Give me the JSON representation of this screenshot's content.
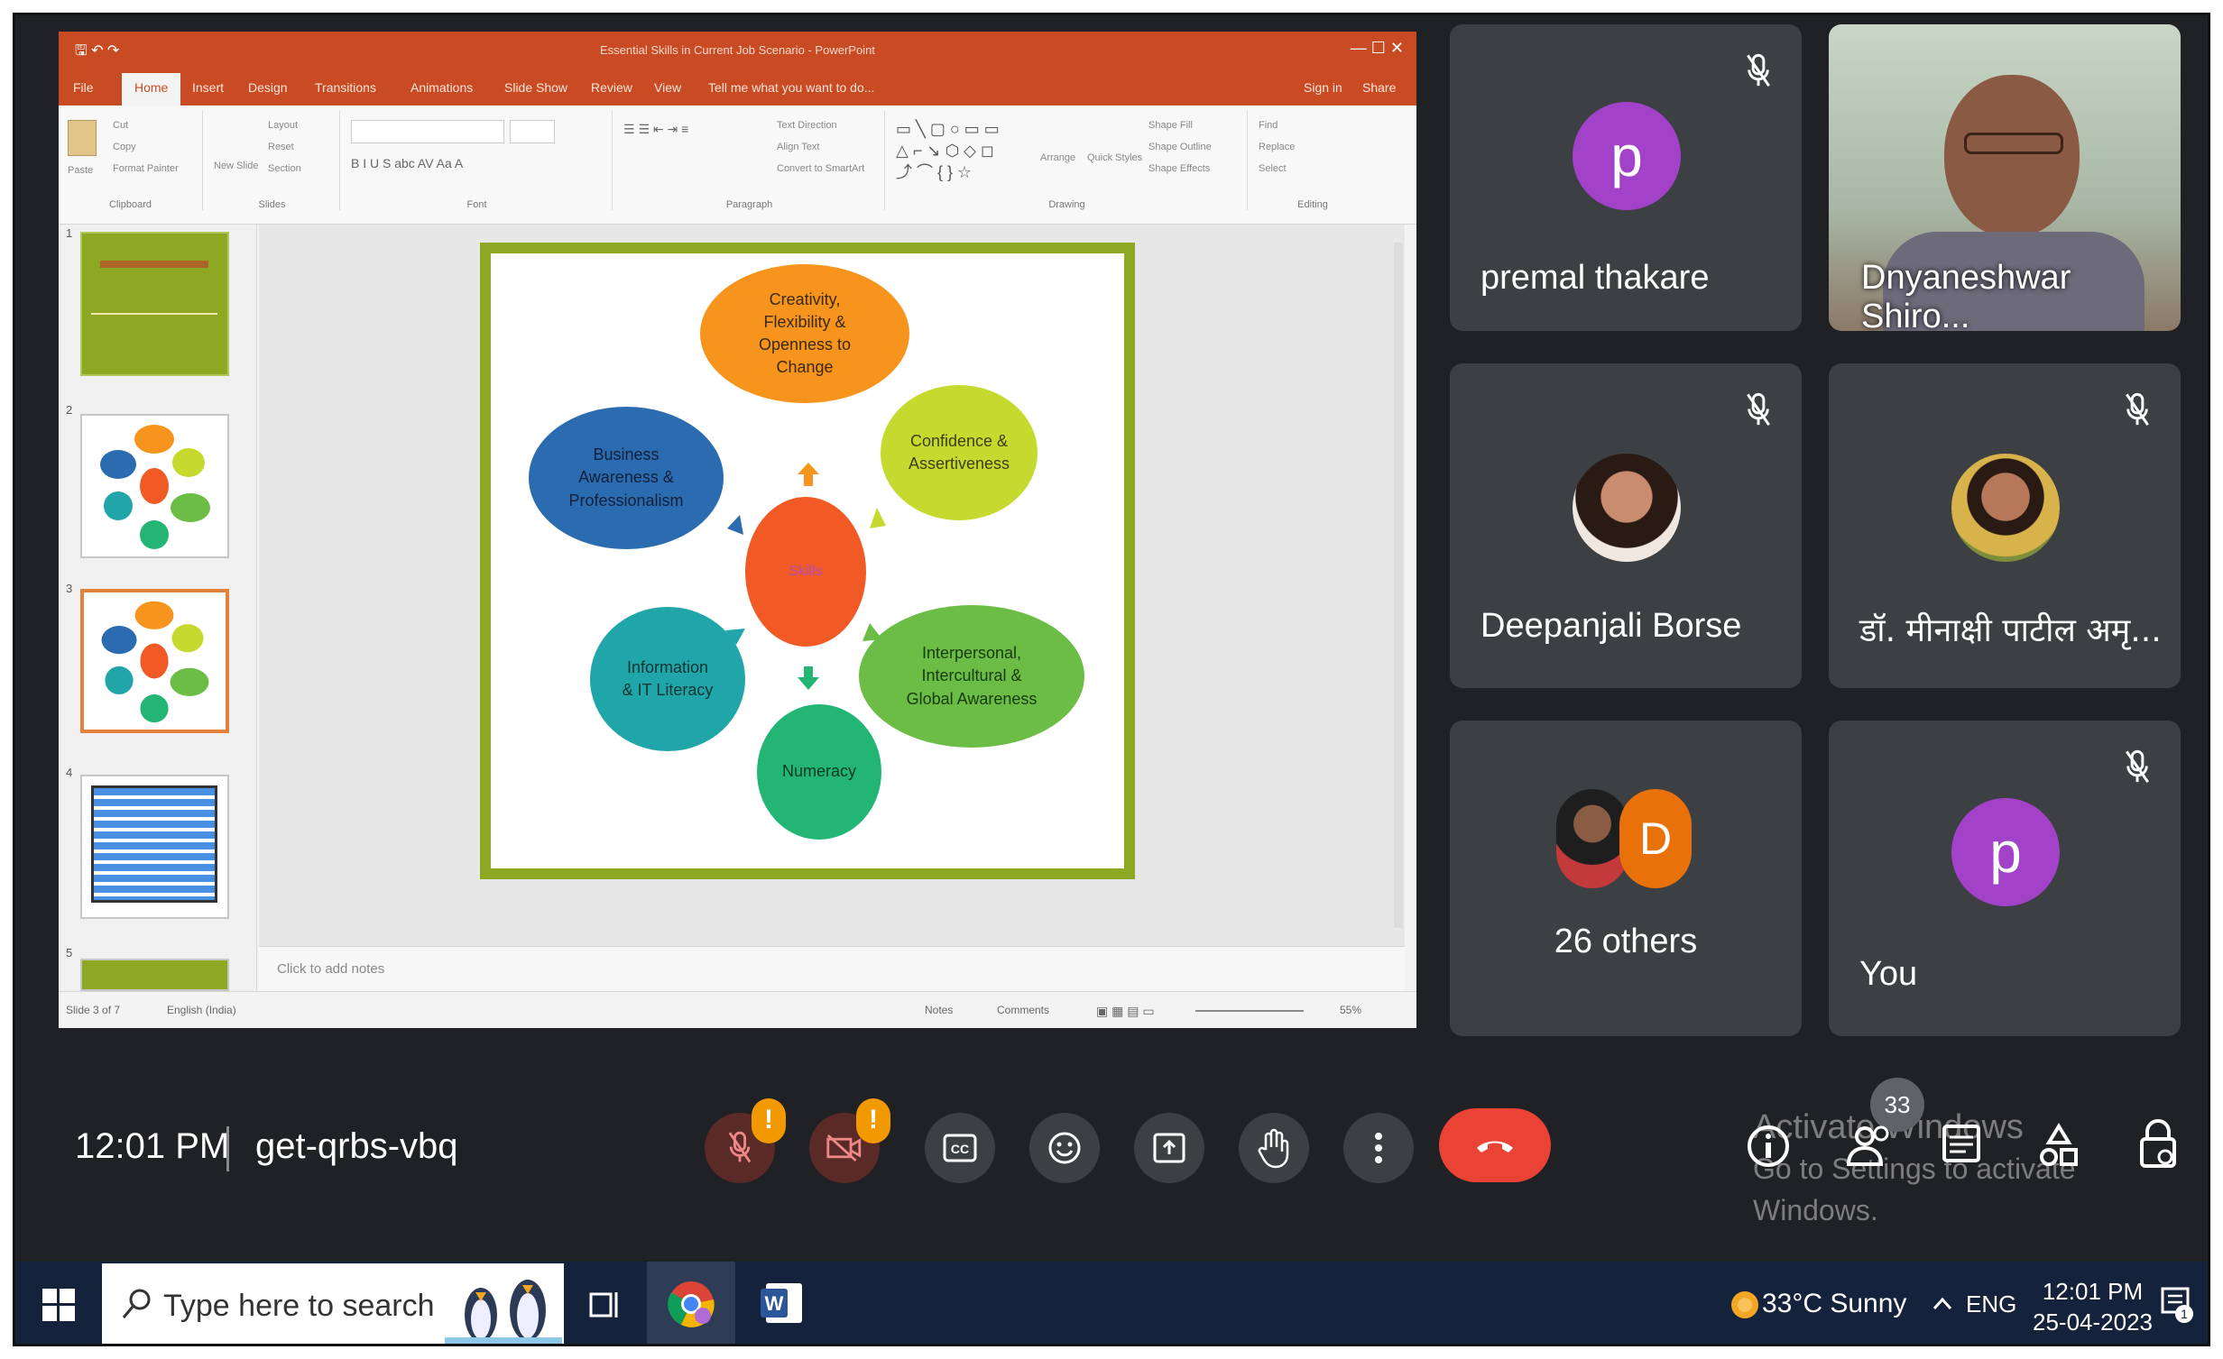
{
  "presentation": {
    "window_title": "Essential Skills in Current Job Scenario - PowerPoint",
    "tabs": [
      "File",
      "Home",
      "Insert",
      "Design",
      "Transitions",
      "Animations",
      "Slide Show",
      "Review",
      "View"
    ],
    "tell_me": "Tell me what you want to do...",
    "sign_in": "Sign in",
    "share": "Share",
    "ribbon_groups": [
      "Clipboard",
      "Slides",
      "Font",
      "Paragraph",
      "Drawing",
      "Editing"
    ],
    "ribbon_buttons": {
      "paste": "Paste",
      "cut": "Cut",
      "copy": "Copy",
      "format_painter": "Format Painter",
      "new_slide": "New Slide",
      "layout": "Layout",
      "reset": "Reset",
      "section": "Section",
      "find": "Find",
      "replace": "Replace",
      "select": "Select",
      "arrange": "Arrange",
      "quick_styles": "Quick Styles",
      "shape_fill": "Shape Fill",
      "shape_outline": "Shape Outline",
      "shape_effects": "Shape Effects",
      "text_direction": "Text Direction",
      "align_text": "Align Text",
      "convert_smartart": "Convert to SmartArt"
    },
    "thumbnail_numbers": [
      "1",
      "2",
      "3",
      "4",
      "5"
    ],
    "notes_placeholder": "Click to add notes",
    "status_slide": "Slide 3 of 7",
    "status_lang": "English (India)",
    "status_notes": "Notes",
    "status_comments": "Comments",
    "zoom": "55%"
  },
  "slide": {
    "center": "Skills",
    "nodes": [
      {
        "id": "creativity",
        "lines": [
          "Creativity,",
          "Flexibility &",
          "Openness to",
          "Change"
        ],
        "color": "#f7941d"
      },
      {
        "id": "confidence",
        "lines": [
          "Confidence &",
          "Assertiveness"
        ],
        "color": "#c6d92f"
      },
      {
        "id": "interpersonal",
        "lines": [
          "Interpersonal,",
          "Intercultural &",
          "Global Awareness"
        ],
        "color": "#6cbd45"
      },
      {
        "id": "numeracy",
        "lines": [
          "Numeracy"
        ],
        "color": "#22b573"
      },
      {
        "id": "information",
        "lines": [
          "Information",
          "& IT Literacy"
        ],
        "color": "#20a6a8"
      },
      {
        "id": "business",
        "lines": [
          "Business",
          "Awareness &",
          "Professionalism"
        ],
        "color": "#2b6cb0"
      }
    ],
    "center_color": "#f15a24"
  },
  "participants": [
    {
      "name": "premal thakare",
      "avatar_letter": "p",
      "avatar_color": "#a142c9",
      "muted": true
    },
    {
      "name": "Dnyaneshwar Shiro...",
      "video": true,
      "muted": false
    },
    {
      "name": "Deepanjali Borse",
      "photo": true,
      "muted": true
    },
    {
      "name": "डॉ. मीनाक्षी पाटील अमृ...",
      "photo": true,
      "muted": true
    },
    {
      "name": "26 others",
      "avatar_letter": "D",
      "avatar_color": "#e8710a"
    },
    {
      "name": "You",
      "avatar_letter": "p",
      "avatar_color": "#a142c9",
      "muted": true
    }
  ],
  "meeting": {
    "time": "12:01 PM",
    "code": "get-qrbs-vbq",
    "warning_symbol": "!",
    "participant_count": "33"
  },
  "watermark": {
    "line1": "Activate Windows",
    "line2": "Go to Settings to activate Windows."
  },
  "taskbar": {
    "search_placeholder": "Type here to search",
    "weather": "33°C  Sunny",
    "lang": "ENG",
    "time": "12:01 PM",
    "date": "25-04-2023",
    "notification_count": "1"
  },
  "colors": {
    "meet_bg": "#202124",
    "tile_bg": "#3c4043",
    "accent_red": "#ea4335",
    "ppt_orange": "#c84b23",
    "slide_border": "#8ea824"
  }
}
